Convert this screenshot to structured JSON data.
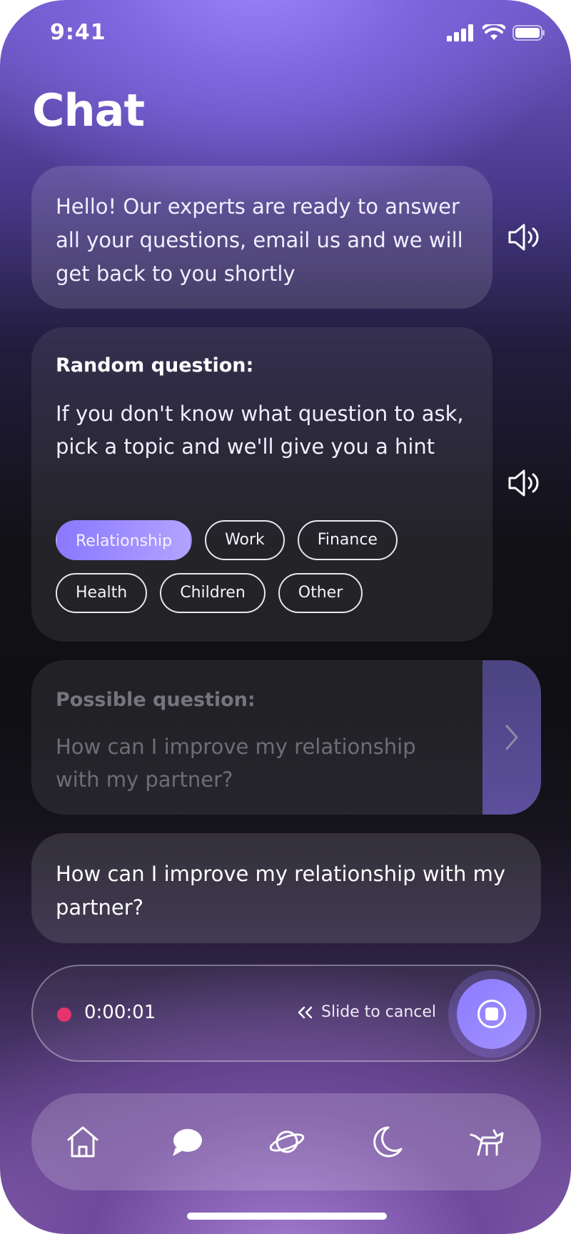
{
  "status_bar": {
    "time": "9:41"
  },
  "header": {
    "title": "Chat"
  },
  "messages": {
    "greeting": {
      "text": "Hello! Our experts are ready to answer all your questions, email us and we will get back to you shortly"
    },
    "random_question": {
      "heading": "Random question:",
      "text": "If you don't know what question to ask, pick a topic and we'll give you a hint",
      "topics": [
        "Relationship",
        "Work",
        "Finance",
        "Health",
        "Children",
        "Other"
      ],
      "selected_topic": "Relationship"
    },
    "possible_question": {
      "heading": "Possible question:",
      "text": "How can I improve my relationship with my partner?"
    },
    "user_message": {
      "text": "How can I improve my relationship with my partner?"
    }
  },
  "recorder": {
    "elapsed": "0:00:01",
    "cancel_hint": "Slide to cancel",
    "indicator_color": "#e5346d"
  },
  "tab_bar": {
    "items": [
      {
        "icon": "home-icon"
      },
      {
        "icon": "chat-icon",
        "active": true
      },
      {
        "icon": "planet-icon"
      },
      {
        "icon": "moon-icon"
      },
      {
        "icon": "cat-icon"
      }
    ]
  },
  "colors": {
    "accent": "#8c7bff",
    "chip_active_start": "#8a78ff",
    "chip_active_end": "#b3a3ff"
  }
}
